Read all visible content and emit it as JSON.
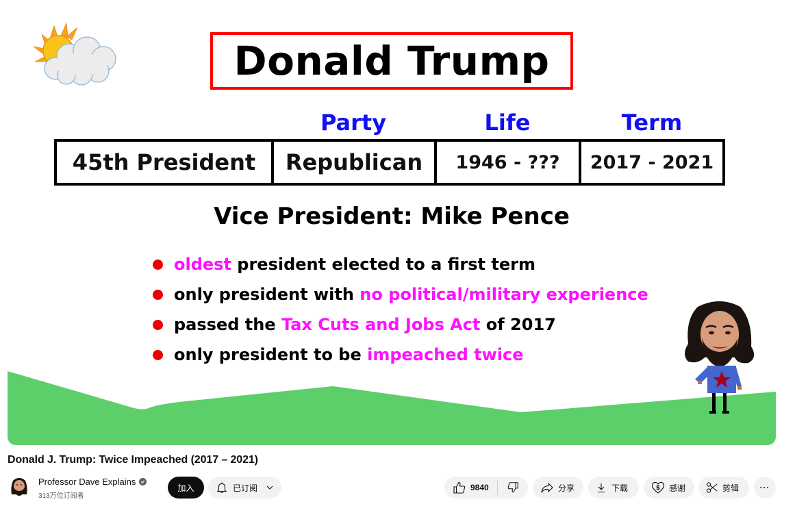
{
  "slide": {
    "title": "Donald Trump",
    "column_headers": {
      "party": "Party",
      "life": "Life",
      "term": "Term"
    },
    "info_row": {
      "rank": "45th President",
      "party": "Republican",
      "life": "1946 - ???",
      "term": "2017 - 2021"
    },
    "vice_president": "Vice President: Mike Pence",
    "facts": [
      {
        "pre": "",
        "highlight": "oldest",
        "post": " president elected to a first term"
      },
      {
        "pre": "only president with ",
        "highlight": "no political/military experience",
        "post": ""
      },
      {
        "pre": "passed the ",
        "highlight": "Tax Cuts and Jobs Act",
        "post": " of 2017"
      },
      {
        "pre": "only president to be ",
        "highlight": "impeached twice",
        "post": ""
      }
    ],
    "colors": {
      "title_border": "#ff0000",
      "header_blue": "#1010f0",
      "highlight_magenta": "#ff10ff",
      "bullet_red": "#ee0000",
      "grass_green": "#5ccf6a",
      "shirt_blue": "#4565cf",
      "star_red": "#a8001a"
    },
    "icons": {
      "weather": "sun-behind-cloud-icon",
      "character": "professor-dave-character"
    }
  },
  "video": {
    "title": "Donald J. Trump: Twice Impeached (2017 – 2021)"
  },
  "channel": {
    "name": "Professor Dave Explains",
    "subscribers": "313万位订阅者",
    "verified": true,
    "join_label": "加入",
    "subscribed_label": "已订阅"
  },
  "actions": {
    "like_count": "9840",
    "share_label": "分享",
    "download_label": "下载",
    "thanks_label": "感谢",
    "clip_label": "剪辑",
    "more_label": "···"
  }
}
